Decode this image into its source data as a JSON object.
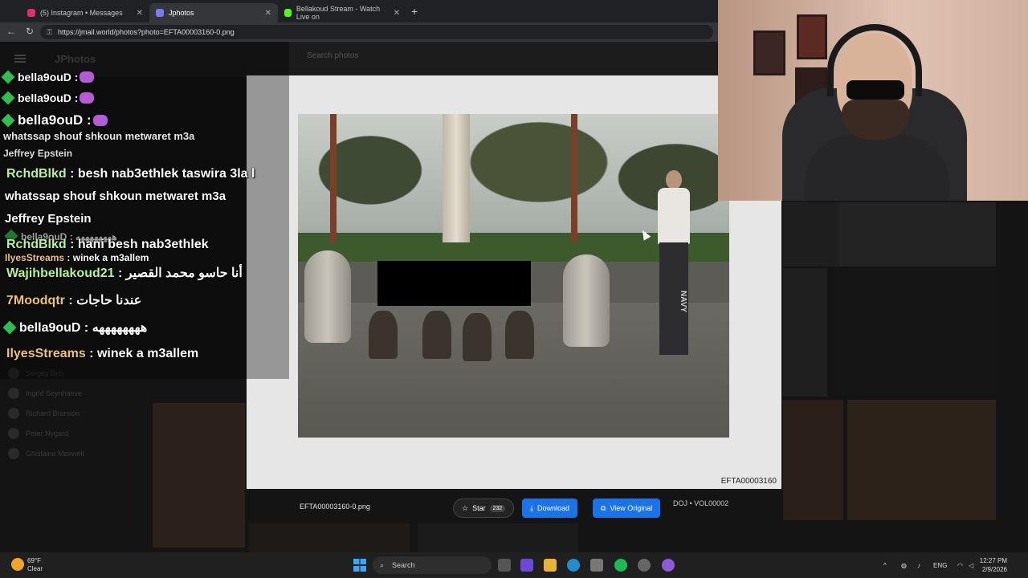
{
  "browser": {
    "tabs": [
      {
        "label": "(5) Instagram • Messages",
        "active": false
      },
      {
        "label": "Jphotos",
        "active": true
      },
      {
        "label": "Bellakoud Stream - Watch Live on",
        "active": false
      }
    ],
    "url": "https://jmail.world/photos?photo=EFTA00003160-0.png"
  },
  "app": {
    "logo": "JPhotos",
    "search_placeholder": "Search photos",
    "sidebar": [
      "Sergey Brin",
      "Ingrid Seynhaeve",
      "Richard Branson",
      "Peter Nygard",
      "Ghislaine Maxwell"
    ]
  },
  "viewer": {
    "photo_id": "EFTA00003160",
    "filename": "EFTA00003160-0.png",
    "star_label": "Star",
    "star_count": "232",
    "download_label": "Download",
    "view_original_label": "View Original",
    "volume": "DOJ • VOL00002",
    "shirt_text": "NAVY"
  },
  "chat": {
    "messages": [
      {
        "user": "bella9ouD",
        "text": "",
        "color": "white",
        "badge": true,
        "emote": true
      },
      {
        "user": "bella9ouD",
        "text": "",
        "color": "white",
        "badge": true,
        "emote": true
      },
      {
        "user": "bella9ouD",
        "text": "",
        "color": "white",
        "badge": true,
        "emote": true
      },
      {
        "user": "RchdBlkd",
        "text": "besh nab3ethlek taswira 3la l whatssap shouf shkoun metwaret m3a Jeffrey Epstein",
        "color": "green",
        "badge": false
      },
      {
        "user": "bella9ouD",
        "text": "ههههههههه",
        "color": "white",
        "badge": true
      },
      {
        "user": "RchdBlkd",
        "text": "hani besh nab3ethlek",
        "color": "green",
        "badge": false
      },
      {
        "user": "IlyesStreams",
        "text": "winek a m3allem",
        "color": "gold",
        "badge": false
      },
      {
        "user": "Wajihbellakoud21",
        "text": "أنا حاسو محمد القصير",
        "color": "green",
        "badge": false
      },
      {
        "user": "7Moodqtr",
        "text": "عندنا حاجات",
        "color": "gold",
        "badge": false
      },
      {
        "user": "bella9ouD",
        "text": "ههههههههه",
        "color": "white",
        "badge": true
      },
      {
        "user": "IlyesStreams",
        "text": "winek a m3allem",
        "color": "gold",
        "badge": false
      }
    ],
    "line1_user": "bella9ouD",
    "line2_user": "bella9ouD",
    "line3_user": "bella9ouD",
    "overlap_text_a": "besh nab3ethlek taswira 3la l",
    "overlap_text_b": "whatssap shouf shkoun metwaret m3a",
    "overlap_text_c": "Jeffrey Epstein",
    "main_user_1": "RchdBlkd",
    "main_text_1": "besh nab3ethlek taswira 3la l",
    "main_text_1b": "whatssap shouf shkoun metwaret m3a",
    "main_text_1c": "Jeffrey Epstein",
    "faded_user": "bella9ouD",
    "faded_text": "ههههههههه",
    "main_user_2": "RchdBlkd",
    "main_text_2": "hani besh nab3ethlek",
    "small_user": "IlyesStreams",
    "small_text": "winek a m3allem",
    "main_user_3": "Wajihbellakoud21",
    "main_text_3": "أنا حاسو محمد القصير",
    "main_user_4": "7Moodqtr",
    "main_text_4": "عندنا حاجات",
    "main_user_5": "bella9ouD",
    "main_text_5": "ههههههههه",
    "main_user_6": "IlyesStreams",
    "main_text_6": "winek a m3allem",
    "sep": ":"
  },
  "taskbar": {
    "temp": "69°F",
    "weather": "Clear",
    "search": "Search",
    "lang": "ENG",
    "time": "12:27 PM",
    "date": "2/9/2026"
  },
  "colors": {
    "accent": "#1a73e8",
    "chat_green": "#b6f58c",
    "chat_gold": "#f2c46b"
  }
}
